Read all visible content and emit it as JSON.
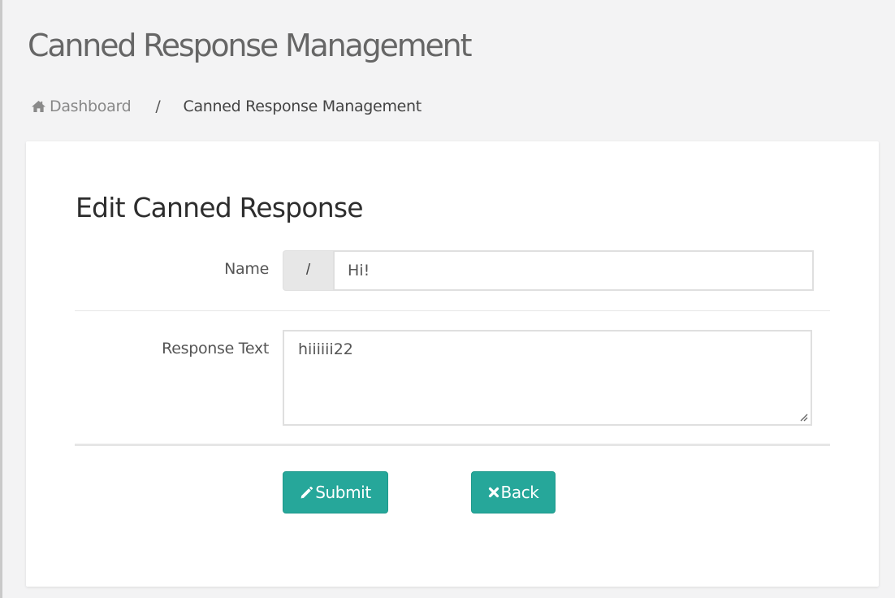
{
  "page": {
    "title": "Canned Response Management"
  },
  "breadcrumb": {
    "home_label": "Dashboard",
    "home_icon": "home-icon",
    "separator": "/",
    "current": "Canned Response Management"
  },
  "form": {
    "title": "Edit Canned Response",
    "name_label": "Name",
    "name_prefix": "/",
    "name_value": "Hi!",
    "response_label": "Response Text",
    "response_value": "hiiiiii22"
  },
  "buttons": {
    "submit_label": "Submit",
    "submit_icon": "pencil-icon",
    "back_label": "Back",
    "back_icon": "close-icon"
  },
  "colors": {
    "accent": "#26a79a",
    "background": "#f3f3f4",
    "card": "#ffffff"
  }
}
